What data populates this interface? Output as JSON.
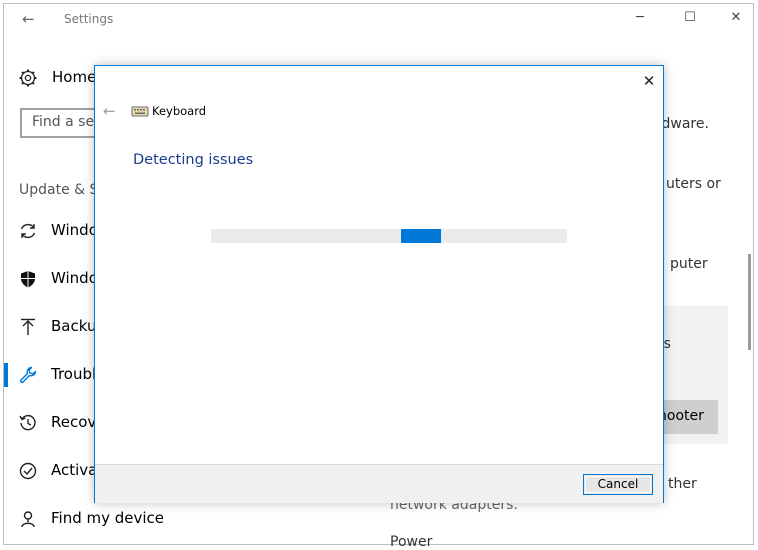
{
  "window": {
    "title": "Settings",
    "back_glyph": "←",
    "minimize_glyph": "─",
    "maximize_glyph": "☐",
    "close_glyph": "✕"
  },
  "sidebar": {
    "home_label": "Home",
    "search_placeholder": "Find a set",
    "section_header": "Update & S",
    "items": [
      {
        "label": "Windo",
        "icon": "sync-icon"
      },
      {
        "label": "Windo",
        "icon": "shield-icon"
      },
      {
        "label": "Backup",
        "icon": "backup-arrow-icon"
      },
      {
        "label": "Troubl",
        "icon": "wrench-icon",
        "selected": true
      },
      {
        "label": "Recove",
        "icon": "history-icon"
      },
      {
        "label": "Activat",
        "icon": "check-circle-icon"
      },
      {
        "label": "Find my device",
        "icon": "person-pin-icon"
      }
    ]
  },
  "main": {
    "line1": "rdware.",
    "line2": "uters or",
    "line3": "puter",
    "line4": "r's",
    "button_label": "hooter",
    "line5": "ther",
    "line6": "network adapters.",
    "line7": "Power"
  },
  "dialog": {
    "close_glyph": "✕",
    "back_glyph": "←",
    "app_name": "Keyboard",
    "heading": "Detecting issues",
    "progress": {
      "chunk_start": 0.535,
      "chunk_width": 0.11
    },
    "cancel_label": "Cancel"
  },
  "colors": {
    "accent": "#0078d7",
    "heading": "#1a3c8c"
  }
}
